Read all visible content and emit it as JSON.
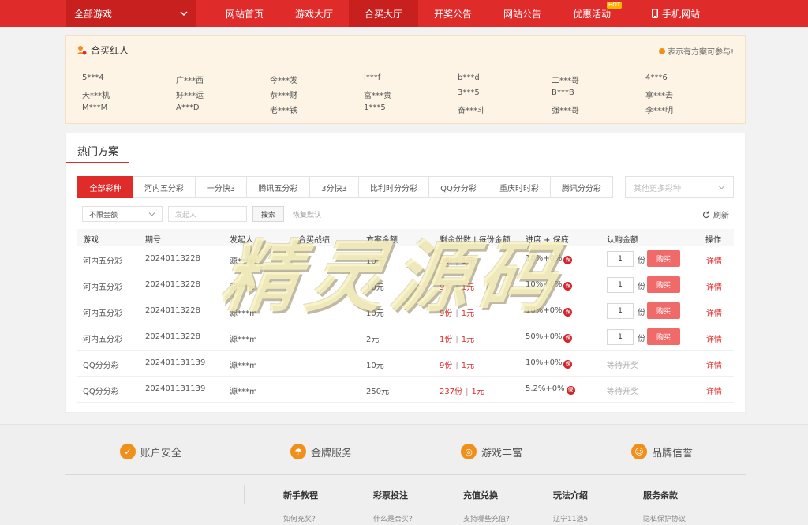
{
  "nav": {
    "all_games": "全部游戏",
    "items": [
      {
        "label": "网站首页",
        "active": false
      },
      {
        "label": "游戏大厅",
        "active": false
      },
      {
        "label": "合买大厅",
        "active": true
      },
      {
        "label": "开奖公告",
        "active": false
      },
      {
        "label": "网站公告",
        "active": false
      },
      {
        "label": "优惠活动",
        "active": false,
        "badge": "HOT"
      }
    ],
    "mobile": "手机网站"
  },
  "celebs": {
    "title": "合买红人",
    "note": "表示有方案可参与!",
    "names": [
      "5***4",
      "广***西",
      "今***发",
      "i***f",
      "b***d",
      "二***哥",
      "4***6",
      "天***机",
      "好***运",
      "恭***财",
      "富***贵",
      "3***5",
      "B***B",
      "拿***去",
      "M***M",
      "A***D",
      "老***铁",
      "1***5",
      "奋***斗",
      "强***哥",
      "李***明"
    ]
  },
  "hot": {
    "title": "热门方案",
    "tabs": [
      "全部彩种",
      "河内五分彩",
      "一分快3",
      "腾讯五分彩",
      "3分快3",
      "比利时分分彩",
      "QQ分分彩",
      "重庆时时彩",
      "腾讯分分彩"
    ],
    "more_select": "其他更多彩种",
    "filter_amount": "不限金额",
    "filter_initiator_placeholder": "发起人",
    "search": "搜索",
    "reset": "恢复默认",
    "refresh": "刷新",
    "headers": {
      "game": "游戏",
      "period": "期号",
      "initiator": "发起人",
      "record": "合买战绩",
      "amount": "方案金额",
      "remain": "剩余份数 | 每份金额",
      "progress": "进度 + 保底",
      "subscribe": "认购金额",
      "action": "操作"
    },
    "rows": [
      {
        "game": "河内五分彩",
        "period": "20240113228",
        "initiator": "源***m",
        "amount": "10元",
        "remain": "9份",
        "per": "1元",
        "progress": "10%+0%",
        "guarantee": "保",
        "qty": "1",
        "unit": "份",
        "buy": "购买",
        "status": "",
        "detail": "详情"
      },
      {
        "game": "河内五分彩",
        "period": "20240113228",
        "initiator": "源***m",
        "amount": "10元",
        "remain": "9份",
        "per": "1元",
        "progress": "10%+0%",
        "guarantee": "保",
        "qty": "1",
        "unit": "份",
        "buy": "购买",
        "status": "",
        "detail": "详情"
      },
      {
        "game": "河内五分彩",
        "period": "20240113228",
        "initiator": "源***m",
        "amount": "10元",
        "remain": "9份",
        "per": "1元",
        "progress": "10%+0%",
        "guarantee": "保",
        "qty": "1",
        "unit": "份",
        "buy": "购买",
        "status": "",
        "detail": "详情"
      },
      {
        "game": "河内五分彩",
        "period": "20240113228",
        "initiator": "源***m",
        "amount": "2元",
        "remain": "1份",
        "per": "1元",
        "progress": "50%+0%",
        "guarantee": "保",
        "qty": "1",
        "unit": "份",
        "buy": "购买",
        "status": "",
        "detail": "详情"
      },
      {
        "game": "QQ分分彩",
        "period": "202401131139",
        "initiator": "源***m",
        "amount": "10元",
        "remain": "9份",
        "per": "1元",
        "progress": "10%+0%",
        "guarantee": "保",
        "qty": "",
        "unit": "",
        "buy": "",
        "status": "等待开奖",
        "detail": "详情"
      },
      {
        "game": "QQ分分彩",
        "period": "202401131139",
        "initiator": "源***m",
        "amount": "250元",
        "remain": "237份",
        "per": "1元",
        "progress": "5.2%+0%",
        "guarantee": "保",
        "qty": "",
        "unit": "",
        "buy": "",
        "status": "等待开奖",
        "detail": "详情"
      }
    ]
  },
  "footer": {
    "features": [
      "账户安全",
      "金牌服务",
      "游戏丰富",
      "品牌信誉"
    ],
    "columns": [
      {
        "title": "新手教程",
        "link": "如何充奖?"
      },
      {
        "title": "彩票投注",
        "link": "什么是合买?"
      },
      {
        "title": "充值兑换",
        "link": "支持哪些充值?"
      },
      {
        "title": "玩法介绍",
        "link": "辽宁11选5"
      },
      {
        "title": "服务条款",
        "link": "隐私保护协议"
      }
    ]
  },
  "watermark": "精灵源码",
  "colors": {
    "brand_red": "#e02b2b",
    "dark_red": "#c81f1f",
    "orange": "#f08f1a",
    "buy_button": "#f06a6a"
  }
}
